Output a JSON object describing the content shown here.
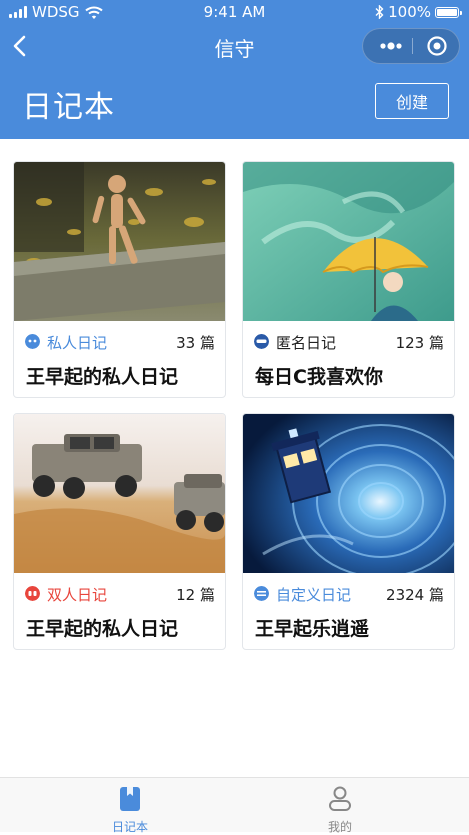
{
  "status_bar": {
    "carrier": "WDSG",
    "time": "9:41 AM",
    "battery": "100%"
  },
  "nav": {
    "title": "信守"
  },
  "header": {
    "title": "日记本",
    "create_label": "创建"
  },
  "colors": {
    "brand": "#4a8bdb",
    "private": "#4a8bdb",
    "anonymous": "#2a5aa8",
    "couple": "#e8453c",
    "custom": "#4a8bdb"
  },
  "cards": [
    {
      "type_label": "私人日记",
      "type_icon": "private-face-icon",
      "count": "33 篇",
      "title": "王早起的私人日记",
      "image": "wooden-mannequin-photo"
    },
    {
      "type_label": "匿名日记",
      "type_icon": "mask-icon",
      "count": "123 篇",
      "title": "每日C我喜欢你",
      "image": "umbrella-girl-illustration"
    },
    {
      "type_label": "双人日记",
      "type_icon": "couple-icon",
      "count": "12 篇",
      "title": "王早起的私人日记",
      "image": "off-road-trucks-photo"
    },
    {
      "type_label": "自定义日记",
      "type_icon": "custom-icon",
      "count": "2324 篇",
      "title": "王早起乐逍遥",
      "image": "time-tunnel-box-photo"
    }
  ],
  "tabs": [
    {
      "label": "日记本",
      "icon": "notebook-icon",
      "active": true
    },
    {
      "label": "我的",
      "icon": "person-icon",
      "active": false
    }
  ]
}
